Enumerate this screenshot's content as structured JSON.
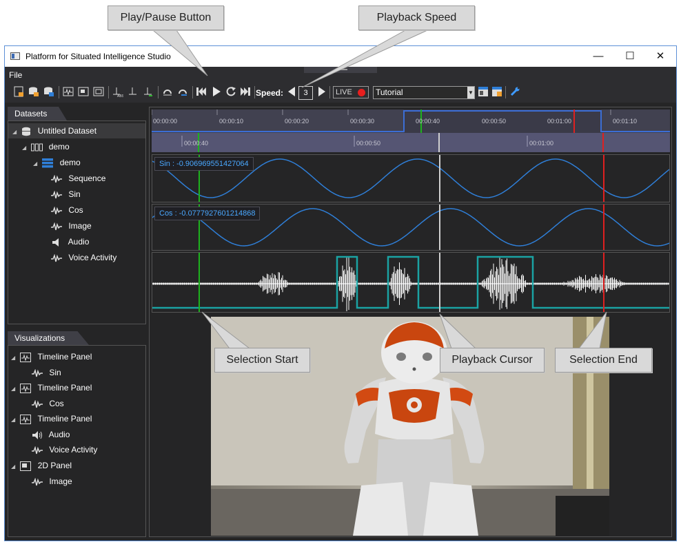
{
  "callouts": {
    "play_pause": "Play/Pause Button",
    "playback_speed": "Playback Speed",
    "selection_start": "Selection Start",
    "playback_cursor": "Playback Cursor",
    "selection_end": "Selection End"
  },
  "window": {
    "title": "Platform for Situated Intelligence Studio",
    "minimize": "—",
    "maximize": "☐",
    "close": "✕"
  },
  "menu": {
    "file": "File"
  },
  "toolbar": {
    "speed_label": "Speed:",
    "speed_value": "3",
    "live_label": "LIVE",
    "layout_value": "Tutorial"
  },
  "datasets": {
    "tab": "Datasets",
    "items": [
      {
        "label": "Untitled Dataset",
        "icon": "database-icon"
      },
      {
        "label": "demo",
        "icon": "session-icon"
      },
      {
        "label": "demo",
        "icon": "partition-icon"
      },
      {
        "label": "Sequence",
        "icon": "signal-icon"
      },
      {
        "label": "Sin",
        "icon": "signal-icon"
      },
      {
        "label": "Cos",
        "icon": "signal-icon"
      },
      {
        "label": "Image",
        "icon": "signal-icon"
      },
      {
        "label": "Audio",
        "icon": "speaker-icon"
      },
      {
        "label": "Voice Activity",
        "icon": "signal-icon"
      }
    ]
  },
  "visualizations": {
    "tab": "Visualizations",
    "items": [
      {
        "label": "Timeline Panel",
        "icon": "timeline-panel-icon"
      },
      {
        "label": "Sin",
        "icon": "signal-icon"
      },
      {
        "label": "Timeline Panel",
        "icon": "timeline-panel-icon"
      },
      {
        "label": "Cos",
        "icon": "signal-icon"
      },
      {
        "label": "Timeline Panel",
        "icon": "timeline-panel-icon"
      },
      {
        "label": "Audio",
        "icon": "speaker-icon"
      },
      {
        "label": "Voice Activity",
        "icon": "signal-icon"
      },
      {
        "label": "2D Panel",
        "icon": "2d-panel-icon"
      },
      {
        "label": "Image",
        "icon": "signal-icon"
      }
    ]
  },
  "timeline": {
    "overview_ticks": [
      "00:00:00",
      "00:00:10",
      "00:00:20",
      "00:00:30",
      "00:00:40",
      "00:00:50",
      "00:01:00",
      "00:01:10"
    ],
    "detail_ticks": [
      "00:00:40",
      "00:00:50",
      "00:01:00"
    ]
  },
  "plots": {
    "sin_label": "Sin  :  -0.906969551427064",
    "cos_label": "Cos  :  -0.0777927601214868"
  },
  "colors": {
    "accent_blue": "#2f7fd8",
    "selection_start": "#1db31d",
    "selection_end": "#e02020",
    "cursor": "#d0d0d0",
    "voice": "#1aa3a3"
  }
}
